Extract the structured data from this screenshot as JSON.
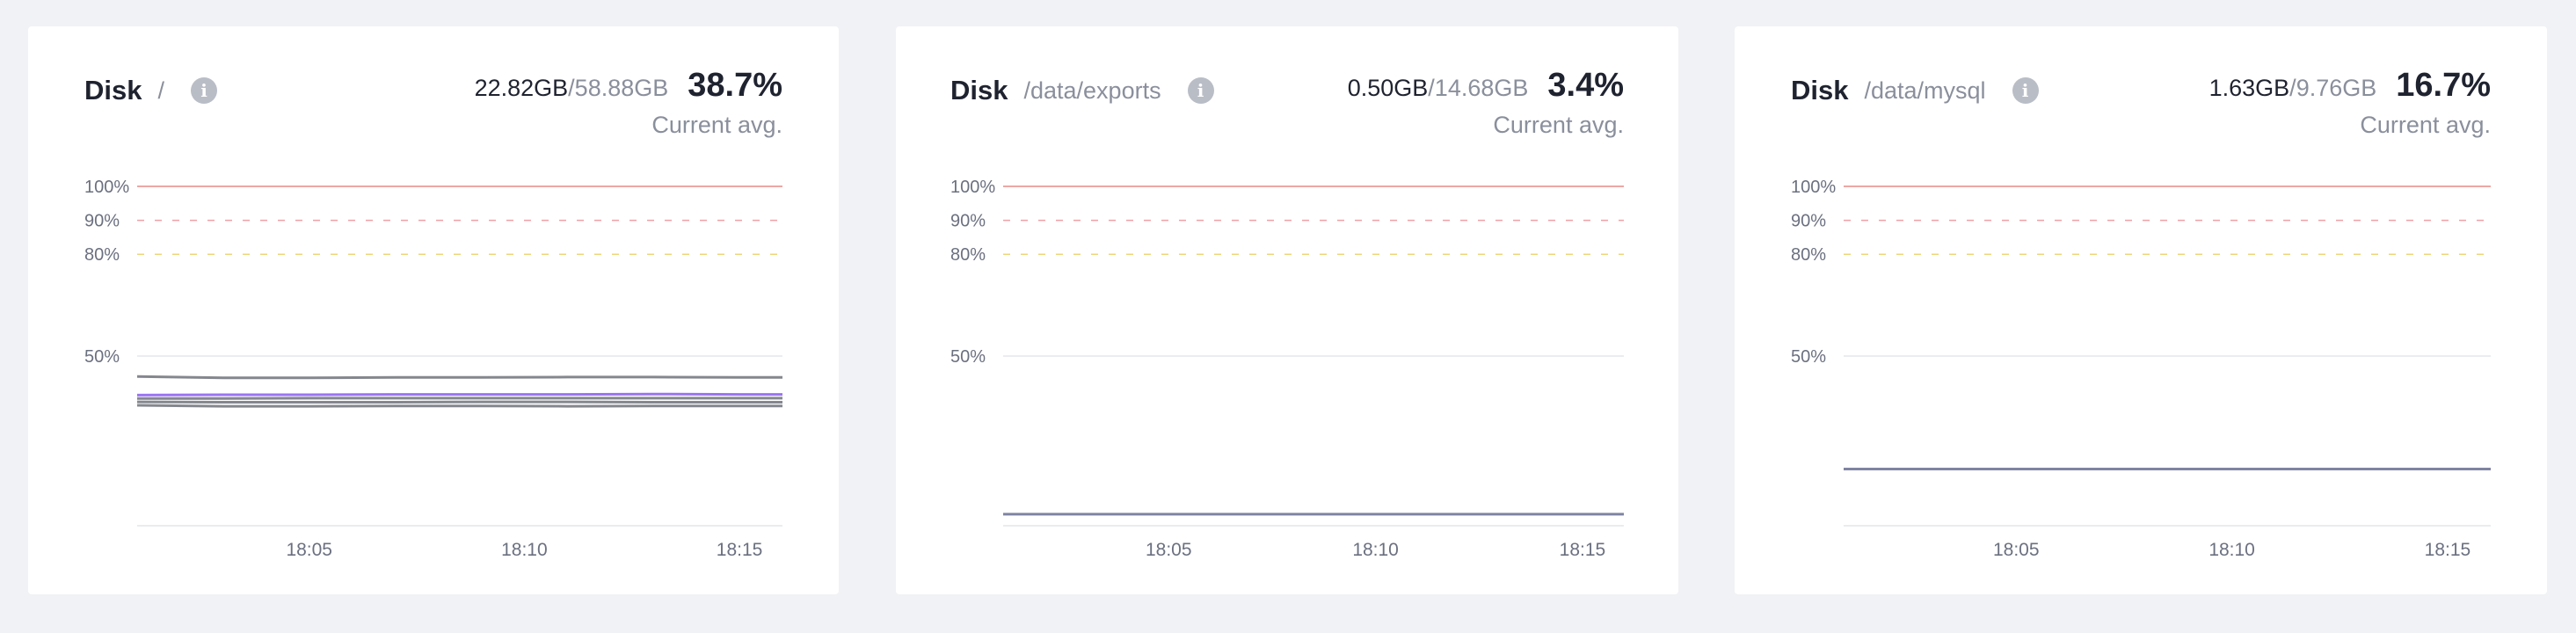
{
  "colors": {
    "limit_100": "#e58a86",
    "limit_90": "#f0a0a6",
    "limit_80": "#efd57a",
    "grid": "#e4e6ea",
    "series_gray": "#6f727a",
    "series_purple": "#8a5cf0",
    "series_slate": "#6a6e92"
  },
  "cards": [
    {
      "title": "Disk",
      "mount": "/",
      "used": "22.82GB",
      "total": "58.88GB",
      "percent": "38.7%",
      "avg_label": "Current avg.",
      "info_icon": "info-icon"
    },
    {
      "title": "Disk",
      "mount": "/data/exports",
      "used": "0.50GB",
      "total": "14.68GB",
      "percent": "3.4%",
      "avg_label": "Current avg.",
      "info_icon": "info-icon"
    },
    {
      "title": "Disk",
      "mount": "/data/mysql",
      "used": "1.63GB",
      "total": "9.76GB",
      "percent": "16.7%",
      "avg_label": "Current avg.",
      "info_icon": "info-icon"
    }
  ],
  "chart_data": [
    {
      "type": "line",
      "ylim": [
        0,
        100
      ],
      "y_ticks": [
        {
          "v": 100,
          "label": "100%"
        },
        {
          "v": 90,
          "label": "90%"
        },
        {
          "v": 80,
          "label": "80%"
        },
        {
          "v": 50,
          "label": "50%"
        }
      ],
      "thresholds": [
        100,
        90,
        80
      ],
      "x_ticks": [
        "18:05",
        "18:10",
        "18:15"
      ],
      "x": [
        "18:01",
        "18:03",
        "18:05",
        "18:07",
        "18:09",
        "18:11",
        "18:13",
        "18:15",
        "18:16"
      ],
      "series": [
        {
          "color": "series_gray",
          "values": [
            44,
            43.6,
            43.6,
            43.7,
            43.7,
            43.8,
            43.8,
            43.7,
            43.7
          ]
        },
        {
          "color": "series_purple",
          "values": [
            38.5,
            38.6,
            38.6,
            38.7,
            38.7,
            38.7,
            38.8,
            38.7,
            38.7
          ]
        },
        {
          "color": "series_gray",
          "values": [
            37.5,
            37.5,
            37.6,
            37.6,
            37.6,
            37.6,
            37.6,
            37.6,
            37.6
          ]
        },
        {
          "color": "series_gray",
          "values": [
            36.5,
            36.4,
            36.4,
            36.4,
            36.5,
            36.5,
            36.4,
            36.4,
            36.4
          ]
        },
        {
          "color": "series_gray",
          "values": [
            35.5,
            35.2,
            35.2,
            35.3,
            35.3,
            35.2,
            35.3,
            35.3,
            35.3
          ]
        }
      ]
    },
    {
      "type": "line",
      "ylim": [
        0,
        100
      ],
      "y_ticks": [
        {
          "v": 100,
          "label": "100%"
        },
        {
          "v": 90,
          "label": "90%"
        },
        {
          "v": 80,
          "label": "80%"
        },
        {
          "v": 50,
          "label": "50%"
        }
      ],
      "thresholds": [
        100,
        90,
        80
      ],
      "x_ticks": [
        "18:05",
        "18:10",
        "18:15"
      ],
      "x": [
        "18:01",
        "18:03",
        "18:05",
        "18:07",
        "18:09",
        "18:11",
        "18:13",
        "18:15",
        "18:16"
      ],
      "series": [
        {
          "color": "series_slate",
          "values": [
            3.4,
            3.4,
            3.4,
            3.4,
            3.4,
            3.4,
            3.4,
            3.4,
            3.4
          ]
        }
      ]
    },
    {
      "type": "line",
      "ylim": [
        0,
        100
      ],
      "y_ticks": [
        {
          "v": 100,
          "label": "100%"
        },
        {
          "v": 90,
          "label": "90%"
        },
        {
          "v": 80,
          "label": "80%"
        },
        {
          "v": 50,
          "label": "50%"
        }
      ],
      "thresholds": [
        100,
        90,
        80
      ],
      "x_ticks": [
        "18:05",
        "18:10",
        "18:15"
      ],
      "x": [
        "18:01",
        "18:03",
        "18:05",
        "18:07",
        "18:09",
        "18:11",
        "18:13",
        "18:15",
        "18:16"
      ],
      "series": [
        {
          "color": "series_slate",
          "values": [
            16.7,
            16.7,
            16.7,
            16.7,
            16.7,
            16.7,
            16.7,
            16.7,
            16.7
          ]
        }
      ]
    }
  ]
}
